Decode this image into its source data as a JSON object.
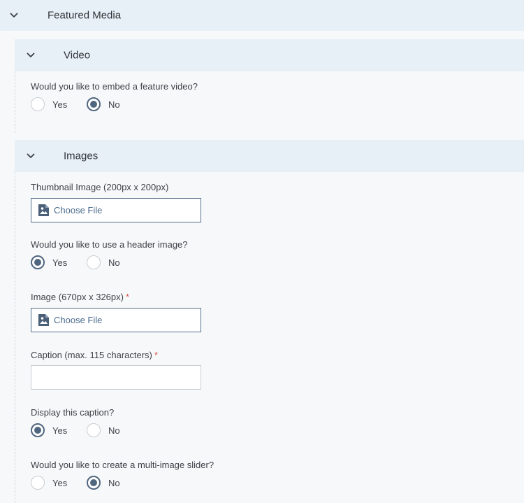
{
  "sections": {
    "featured_media": {
      "title": "Featured Media"
    },
    "video": {
      "title": "Video"
    },
    "images": {
      "title": "Images"
    }
  },
  "video": {
    "embed_question": "Would you like to embed a feature video?",
    "embed_options": [
      {
        "label": "Yes",
        "checked": false
      },
      {
        "label": "No",
        "checked": true
      }
    ]
  },
  "images": {
    "thumbnail_label": "Thumbnail Image (200px x 200px)",
    "thumbnail_button": "Choose File",
    "header_question": "Would you like to use a header image?",
    "header_options": [
      {
        "label": "Yes",
        "checked": true
      },
      {
        "label": "No",
        "checked": false
      }
    ],
    "image_label": "Image (670px x 326px)",
    "image_required": "*",
    "image_button": "Choose File",
    "caption_label": "Caption (max. 115 characters)",
    "caption_required": "*",
    "caption_value": "",
    "display_caption_question": "Display this caption?",
    "display_caption_options": [
      {
        "label": "Yes",
        "checked": true
      },
      {
        "label": "No",
        "checked": false
      }
    ],
    "slider_question": "Would you like to create a multi-image slider?",
    "slider_options": [
      {
        "label": "Yes",
        "checked": false
      },
      {
        "label": "No",
        "checked": true
      }
    ]
  },
  "icons": {
    "collapse": "chevron-down-icon",
    "file": "file-image-icon"
  },
  "colors": {
    "header_bg": "#e8f0f7",
    "page_bg": "#f7f8fa",
    "accent": "#50667f",
    "link": "#4b6b8c",
    "required": "#d9534f"
  }
}
